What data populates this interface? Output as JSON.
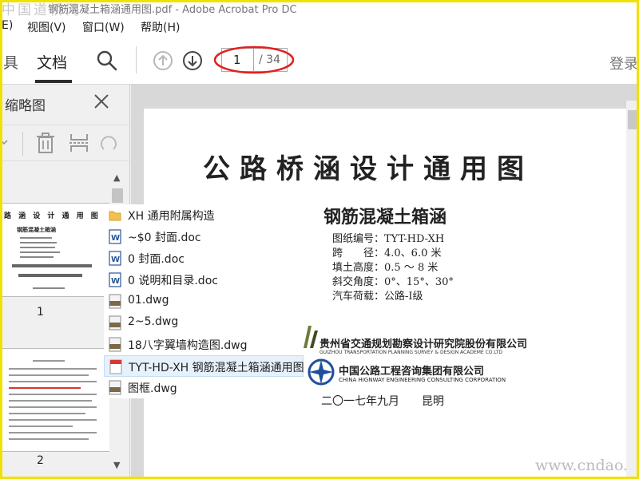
{
  "titlebar": {
    "watermark": "中国道桥网",
    "title": "钢筋混凝土箱涵通用图.pdf - Adobe Acrobat Pro DC"
  },
  "menu": [
    {
      "label": "E)"
    },
    {
      "label": "视图(V)"
    },
    {
      "label": "窗口(W)"
    },
    {
      "label": "帮助(H)"
    }
  ],
  "toolbar": {
    "tools_tab": "具",
    "document_tab": "文档",
    "current_page": "1",
    "total_pages": "/ 34",
    "login": "登录",
    "annotation_color": "#e02020"
  },
  "thumbnails": {
    "title": "缩略图",
    "page1": {
      "heading": "路 涵 设 计 通 用 图",
      "subtitle": "钢筋混凝土箱涵",
      "number": "1"
    },
    "page2": {
      "number": "2"
    }
  },
  "document": {
    "title": "公路桥涵设计通用图",
    "subtitle": "钢筋混凝土箱涵",
    "specs": [
      "图纸编号：TYT-HD-XH",
      "跨　　径：4.0、6.0 米",
      "填土高度：0.5 ～ 8 米",
      "斜交角度：0°、15°、30°",
      "汽车荷载：公路-Ⅰ级"
    ],
    "org1": "贵州省交通规划勘察设计研究院股份有限公司",
    "org1_en": "GUIZHOU TRANSPORTATION PLANNING SURVEY & DESIGN ACADEME CO.LTD",
    "org2": "中国公路工程咨询集团有限公司",
    "org2_en": "CHINA HIGNWAY ENGINEERING CONSULTING CORPORATION",
    "date": "二〇一七年九月　　昆明",
    "site_watermark": "www.cndao.com"
  },
  "files": [
    {
      "name": "XH 通用附属构造",
      "icon": "folder-icon"
    },
    {
      "name": "~$0 封面.doc",
      "icon": "word-doc-icon"
    },
    {
      "name": "0 封面.doc",
      "icon": "word-doc-icon"
    },
    {
      "name": "0 说明和目录.doc",
      "icon": "word-doc-icon"
    },
    {
      "name": "01.dwg",
      "icon": "dwg-file-icon"
    },
    {
      "name": "2~5.dwg",
      "icon": "dwg-file-icon"
    },
    {
      "name": "18八字翼墙构造图.dwg",
      "icon": "dwg-file-icon"
    },
    {
      "name": "TYT-HD-XH 钢筋混凝土箱涵通用图.pdf",
      "icon": "pdf-file-icon"
    },
    {
      "name": "图框.dwg",
      "icon": "dwg-file-icon"
    }
  ]
}
